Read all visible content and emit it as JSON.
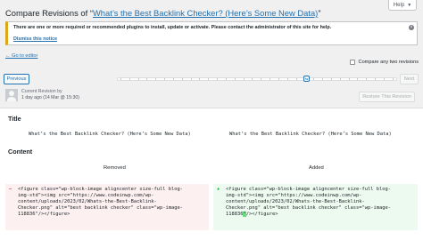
{
  "help": {
    "label": "Help",
    "icon": "caret-down-icon"
  },
  "header": {
    "title_prefix": "Compare Revisions of “",
    "title_link": "What’s the Best Backlink Checker? (Here’s Some New Data)",
    "title_suffix": "”"
  },
  "notice": {
    "text": "There are one or more required or recommended plugins to install, update or activate. Please contact the administrator of this site for help.",
    "dismiss": "Dismiss this notice"
  },
  "go_to_editor": "← Go to editor",
  "compare_any_two": "Compare any two revisions",
  "nav": {
    "previous": "Previous",
    "next": "Next"
  },
  "revision": {
    "label": "Current Revision by",
    "time": "1 day ago (14 Mar @ 15:30)",
    "restore": "Restore This Revision"
  },
  "diff": {
    "title_heading": "Title",
    "title_left": "What’s the Best Backlink Checker? (Here’s Some New Data)",
    "title_right": "What’s the Best Backlink Checker? (Here’s Some New Data)",
    "content_heading": "Content",
    "removed_label": "Removed",
    "added_label": "Added",
    "removed_sign": "−",
    "added_sign": "+",
    "removed_lines": [
      "<figure class=\"wp-block-image aligncenter size-full blog-",
      "img-std\"><img src=\"https://www.codeinwp.com/wp-",
      "content/uploads/2023/02/Whats-the-Best-Backlink-",
      "Checker.png\" alt=\"best backlink checker\" class=\"wp-image-",
      "118836\"/></figure>"
    ],
    "added_lines": [
      "<figure class=\"wp-block-image aligncenter size-full blog-",
      "img-std\"><img src=\"https://www.codeinwp.com/wp-",
      "content/uploads/2023/02/Whats-the-Best-Backlink-",
      "Checker.png\" alt=\"best backlink checker\" class=\"wp-image-"
    ],
    "added_last_id": "118836",
    "added_last_hl": "\"",
    "added_last_rest": "/></figure>"
  }
}
